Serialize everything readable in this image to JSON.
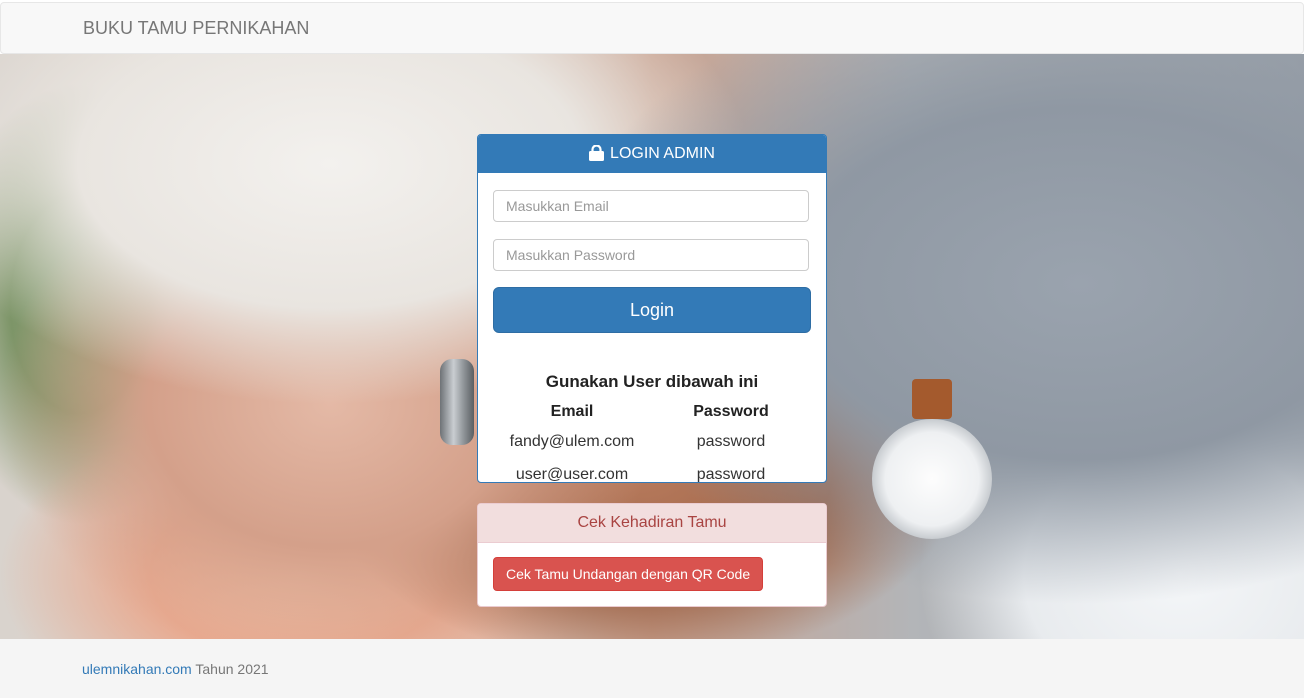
{
  "navbar": {
    "brand": "BUKU TAMU PERNIKAHAN"
  },
  "login_panel": {
    "icon": "lock-icon",
    "title": "LOGIN ADMIN",
    "email_placeholder": "Masukkan Email",
    "password_placeholder": "Masukkan Password",
    "login_label": "Login",
    "info_title": "Gunakan User dibawah ini",
    "columns": [
      "Email",
      "Password"
    ],
    "users": [
      {
        "email": "fandy@ulem.com",
        "password": "password"
      },
      {
        "email": "user@user.com",
        "password": "password"
      }
    ]
  },
  "attendance_panel": {
    "title": "Cek Kehadiran Tamu",
    "qr_button_label": "Cek Tamu Undangan dengan QR Code"
  },
  "footer": {
    "link_text": "ulemnikahan.com",
    "suffix": " Tahun 2021"
  },
  "colors": {
    "primary": "#337ab7",
    "danger": "#d9534f",
    "danger_heading_bg": "#f2dede",
    "danger_heading_text": "#a94442"
  }
}
